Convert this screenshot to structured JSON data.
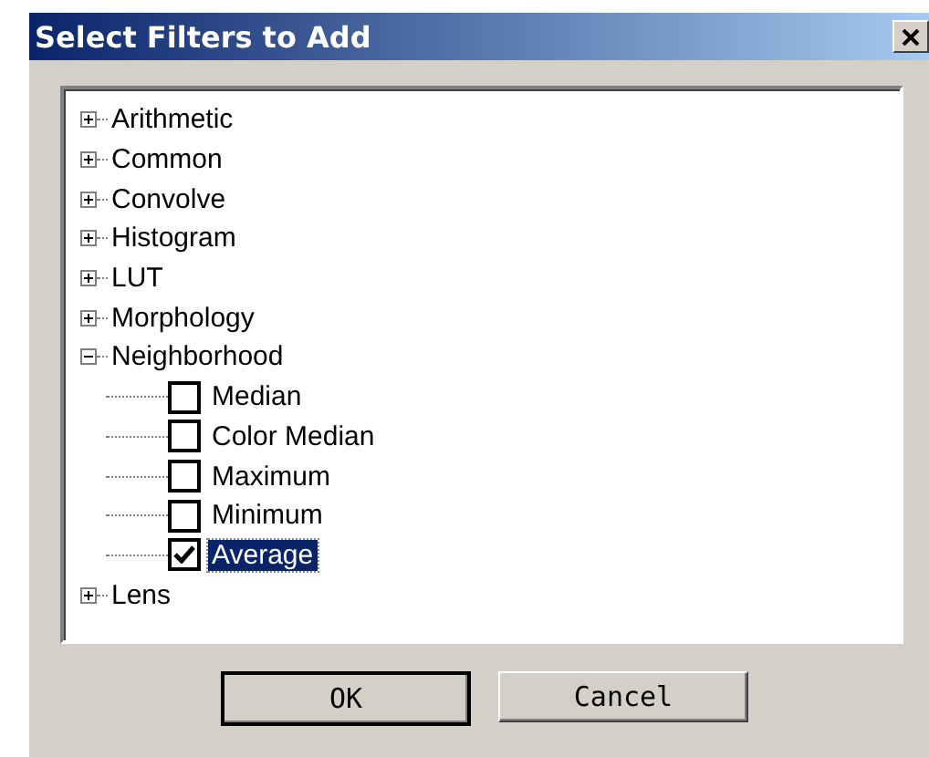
{
  "window": {
    "title": "Select Filters to Add"
  },
  "tree": {
    "items": [
      {
        "label": "Arithmetic",
        "expanded": false
      },
      {
        "label": "Common",
        "expanded": false
      },
      {
        "label": "Convolve",
        "expanded": false
      },
      {
        "label": "Histogram",
        "expanded": false
      },
      {
        "label": "LUT",
        "expanded": false
      },
      {
        "label": "Morphology",
        "expanded": false
      },
      {
        "label": "Neighborhood",
        "expanded": true,
        "children": [
          {
            "label": "Median",
            "checked": false,
            "selected": false
          },
          {
            "label": "Color Median",
            "checked": false,
            "selected": false
          },
          {
            "label": "Maximum",
            "checked": false,
            "selected": false
          },
          {
            "label": "Minimum",
            "checked": false,
            "selected": false
          },
          {
            "label": "Average",
            "checked": true,
            "selected": true
          }
        ]
      },
      {
        "label": "Lens",
        "expanded": false
      }
    ]
  },
  "buttons": [
    {
      "label": "OK",
      "default": true
    },
    {
      "label": "Cancel",
      "default": false
    }
  ]
}
